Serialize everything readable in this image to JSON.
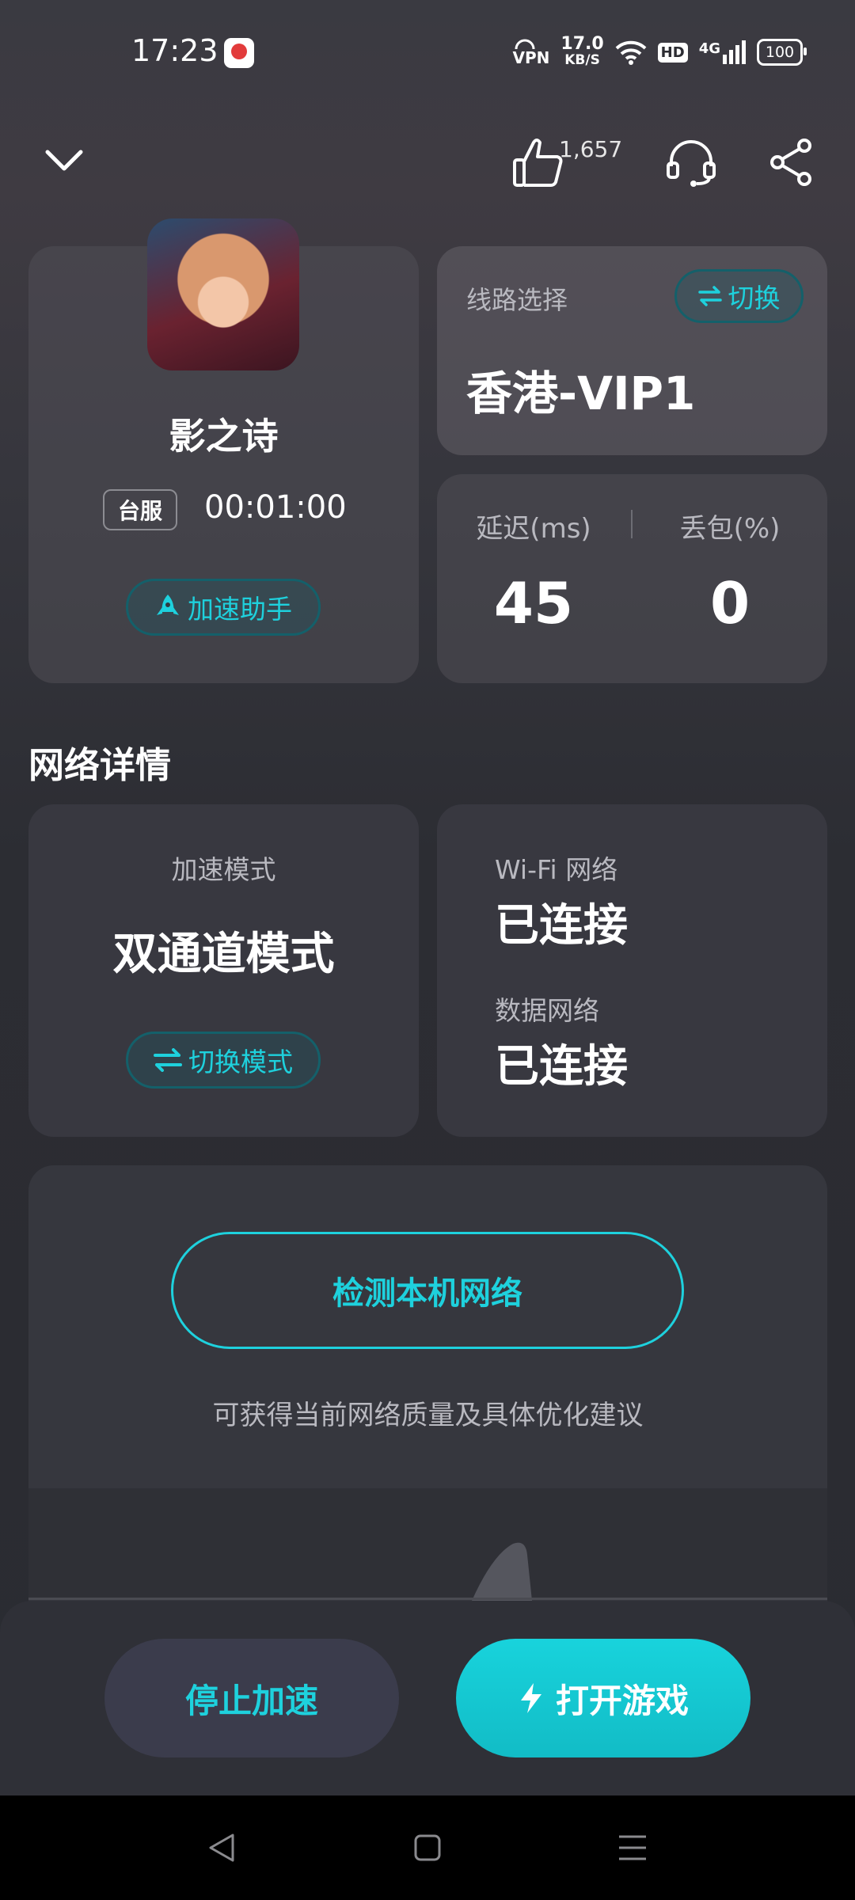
{
  "status_bar": {
    "time": "17:23",
    "vpn": "VPN",
    "speed_value": "17.0",
    "speed_unit": "KB/S",
    "hd": "HD",
    "signal_type": "4G",
    "battery": "100"
  },
  "header": {
    "like_count": "1,657"
  },
  "game": {
    "title": "影之诗",
    "server": "台服",
    "elapsed": "00:01:00",
    "assistant_label": "加速助手"
  },
  "route": {
    "label": "线路选择",
    "switch_label": "切换",
    "value": "香港-VIP1"
  },
  "stats": {
    "latency_label": "延迟(ms)",
    "latency_value": "45",
    "loss_label": "丢包(%)",
    "loss_value": "0"
  },
  "network_details": {
    "section_title": "网络详情",
    "mode_label": "加速模式",
    "mode_value": "双通道模式",
    "switch_mode_label": "切换模式",
    "wifi_label": "Wi-Fi 网络",
    "wifi_value": "已连接",
    "data_label": "数据网络",
    "data_value": "已连接"
  },
  "detect": {
    "button_label": "检测本机网络",
    "hint": "可获得当前网络质量及具体优化建议"
  },
  "actions": {
    "stop_label": "停止加速",
    "open_label": "打开游戏"
  },
  "colors": {
    "accent": "#1ed1dd",
    "pill_border": "#14606a",
    "card": "#383840"
  },
  "icons": [
    "chevron-down-icon",
    "thumbs-up-icon",
    "headset-icon",
    "share-icon",
    "swap-icon",
    "rocket-icon",
    "lightning-icon",
    "nav-back-icon",
    "nav-home-icon",
    "nav-menu-icon"
  ]
}
